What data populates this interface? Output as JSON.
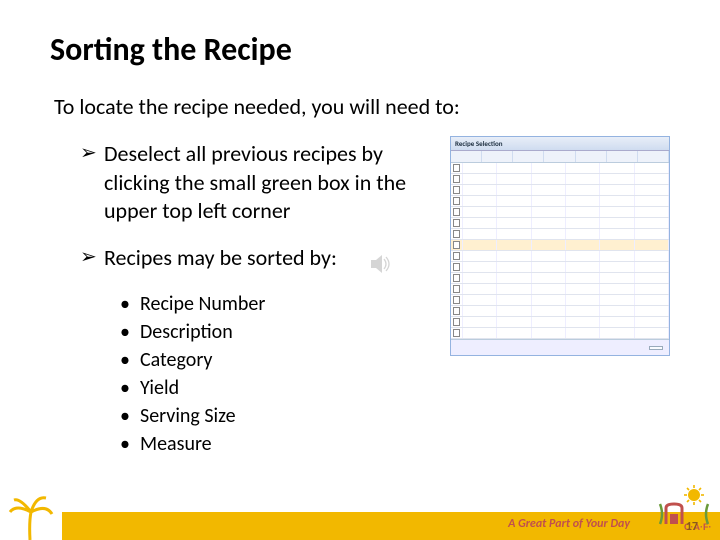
{
  "title": "Sorting the Recipe",
  "intro": "To locate the recipe needed, you will need to:",
  "bullets": {
    "a1": "Deselect all previous recipes by clicking the small green box in the upper top left corner",
    "a2": "Recipes may be sorted by:"
  },
  "sort_fields": {
    "f1": "Recipe Number",
    "f2": "Description",
    "f3": "Category",
    "f4": "Yield",
    "f5": "Serving Size",
    "f6": "Measure"
  },
  "grid": {
    "window_title": "Recipe Selection"
  },
  "footer": {
    "tagline": "A Great Part of Your Day",
    "page_number": "17"
  }
}
